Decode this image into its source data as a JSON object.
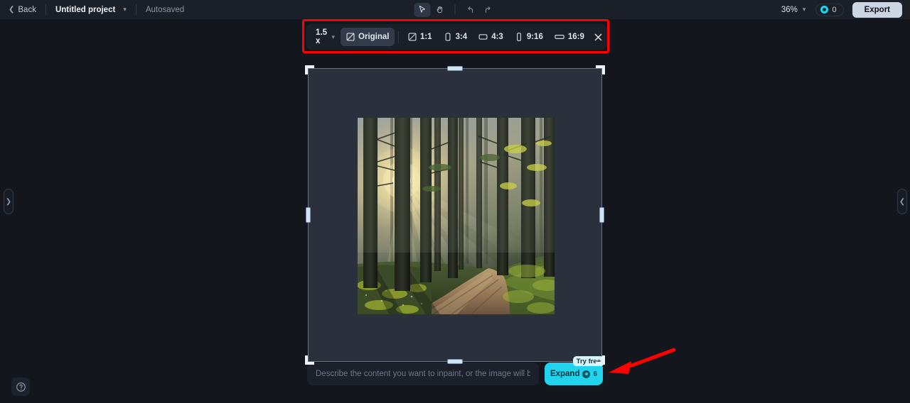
{
  "header": {
    "back_label": "Back",
    "back_icon": "chevron-left-icon",
    "project_name": "Untitled project",
    "project_caret_icon": "chevron-down-icon",
    "autosave_status": "Autosaved",
    "tools": [
      {
        "name": "select-tool",
        "icon": "cursor-arrow-icon",
        "active": true
      },
      {
        "name": "hand-tool",
        "icon": "hand-grab-icon",
        "active": false
      }
    ],
    "history": [
      {
        "name": "undo-button",
        "icon": "undo-arrow-icon"
      },
      {
        "name": "redo-button",
        "icon": "redo-arrow-icon"
      }
    ],
    "zoom_level": "36%",
    "zoom_caret_icon": "chevron-down-icon",
    "credits_icon": "credit-coin-icon",
    "credits_count": "0",
    "export_label": "Export"
  },
  "ratio_toolbar": {
    "highlight_color": "#ff0000",
    "scale_value": "1.5 x",
    "scale_caret_icon": "chevron-down-icon",
    "options": [
      {
        "label": "Original",
        "icon": "crop-original-icon",
        "selected": true
      },
      {
        "label": "1:1",
        "icon": "square-ratio-icon",
        "selected": false
      },
      {
        "label": "3:4",
        "icon": "portrait-ratio-icon",
        "selected": false
      },
      {
        "label": "4:3",
        "icon": "landscape-ratio-icon",
        "selected": false
      },
      {
        "label": "9:16",
        "icon": "tall-portrait-ratio-icon",
        "selected": false
      },
      {
        "label": "16:9",
        "icon": "wide-landscape-ratio-icon",
        "selected": false
      }
    ],
    "close_icon": "close-x-icon"
  },
  "canvas": {
    "image_alt": "Sunbeams through a misty pine forest with a dirt path",
    "frame_color": "#2b313c",
    "handle_color": "#cfe4f2"
  },
  "panels": {
    "left_handle_icon": "chevron-right-icon",
    "right_handle_icon": "chevron-left-icon"
  },
  "prompt": {
    "placeholder": "Describe the content you want to inpaint, or the image will be gene...",
    "value": "",
    "expand_label": "Expand",
    "expand_cost_icon": "credit-coin-icon",
    "expand_cost": "6",
    "badge_label": "Try free",
    "accent_color": "#22d3ee"
  },
  "help": {
    "icon": "question-mark-circle-icon"
  },
  "annotations": {
    "arrow_color": "#ff0000",
    "arrow_icon": "pointer-arrow-annotation"
  }
}
